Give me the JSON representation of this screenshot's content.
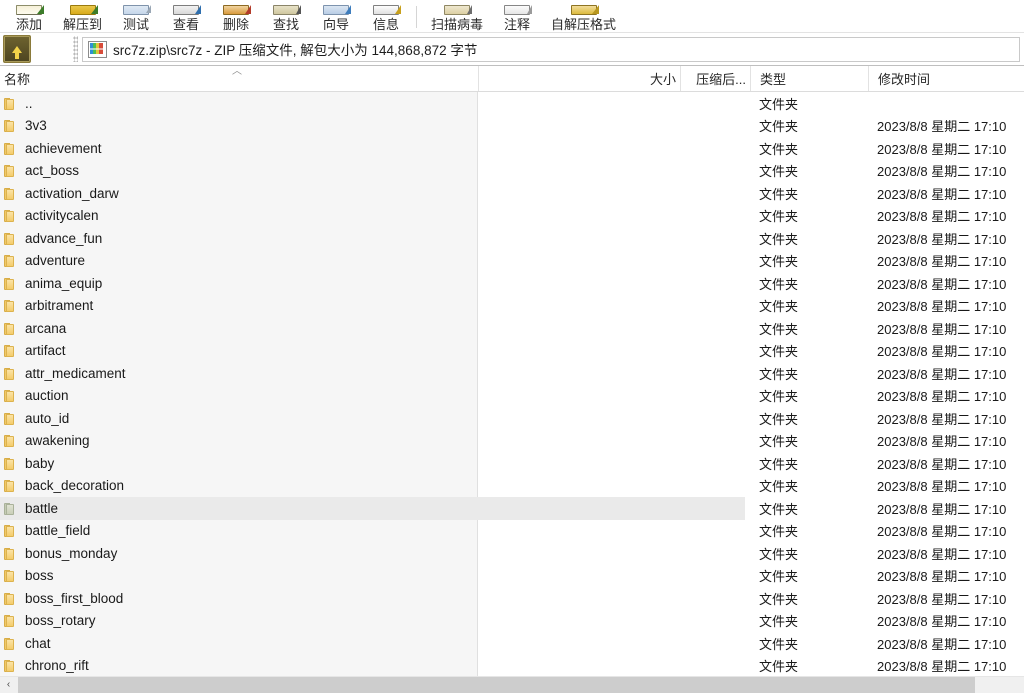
{
  "toolbar": {
    "buttons": [
      {
        "label": "添加",
        "icon": "add-archive-icon",
        "key": "add"
      },
      {
        "label": "解压到",
        "icon": "extract-to-icon",
        "key": "extract"
      },
      {
        "label": "测试",
        "icon": "test-archive-icon",
        "key": "test"
      },
      {
        "label": "查看",
        "icon": "view-file-icon",
        "key": "view"
      },
      {
        "label": "删除",
        "icon": "delete-icon",
        "key": "del"
      },
      {
        "label": "查找",
        "icon": "find-icon",
        "key": "find"
      },
      {
        "label": "向导",
        "icon": "wizard-icon",
        "key": "wizard"
      },
      {
        "label": "信息",
        "icon": "info-icon",
        "key": "info"
      },
      {
        "label": "扫描病毒",
        "icon": "virus-scan-icon",
        "key": "virus"
      },
      {
        "label": "注释",
        "icon": "comment-icon",
        "key": "comment"
      },
      {
        "label": "自解压格式",
        "icon": "sfx-icon",
        "key": "sfx"
      }
    ],
    "separator_after_index": 7
  },
  "addressbar": {
    "up_button_icon": "up-one-level-icon",
    "archive_icon": "zip-archive-icon",
    "path_text": "src7z.zip\\src7z - ZIP 压缩文件, 解包大小为 144,868,872 字节"
  },
  "columns": {
    "name": "名称",
    "size": "大小",
    "packed": "压缩后...",
    "type": "类型",
    "modified": "修改时间",
    "sort_indicator": "︿",
    "sorted_by": "名称"
  },
  "rows": [
    {
      "name": "..",
      "size": "",
      "packed": "",
      "type": "文件夹",
      "modified": "",
      "selected": false
    },
    {
      "name": "3v3",
      "size": "",
      "packed": "",
      "type": "文件夹",
      "modified": "2023/8/8 星期二 17:10",
      "selected": false
    },
    {
      "name": "achievement",
      "size": "",
      "packed": "",
      "type": "文件夹",
      "modified": "2023/8/8 星期二 17:10",
      "selected": false
    },
    {
      "name": "act_boss",
      "size": "",
      "packed": "",
      "type": "文件夹",
      "modified": "2023/8/8 星期二 17:10",
      "selected": false
    },
    {
      "name": "activation_darw",
      "size": "",
      "packed": "",
      "type": "文件夹",
      "modified": "2023/8/8 星期二 17:10",
      "selected": false
    },
    {
      "name": "activitycalen",
      "size": "",
      "packed": "",
      "type": "文件夹",
      "modified": "2023/8/8 星期二 17:10",
      "selected": false
    },
    {
      "name": "advance_fun",
      "size": "",
      "packed": "",
      "type": "文件夹",
      "modified": "2023/8/8 星期二 17:10",
      "selected": false
    },
    {
      "name": "adventure",
      "size": "",
      "packed": "",
      "type": "文件夹",
      "modified": "2023/8/8 星期二 17:10",
      "selected": false
    },
    {
      "name": "anima_equip",
      "size": "",
      "packed": "",
      "type": "文件夹",
      "modified": "2023/8/8 星期二 17:10",
      "selected": false
    },
    {
      "name": "arbitrament",
      "size": "",
      "packed": "",
      "type": "文件夹",
      "modified": "2023/8/8 星期二 17:10",
      "selected": false
    },
    {
      "name": "arcana",
      "size": "",
      "packed": "",
      "type": "文件夹",
      "modified": "2023/8/8 星期二 17:10",
      "selected": false
    },
    {
      "name": "artifact",
      "size": "",
      "packed": "",
      "type": "文件夹",
      "modified": "2023/8/8 星期二 17:10",
      "selected": false
    },
    {
      "name": "attr_medicament",
      "size": "",
      "packed": "",
      "type": "文件夹",
      "modified": "2023/8/8 星期二 17:10",
      "selected": false
    },
    {
      "name": "auction",
      "size": "",
      "packed": "",
      "type": "文件夹",
      "modified": "2023/8/8 星期二 17:10",
      "selected": false
    },
    {
      "name": "auto_id",
      "size": "",
      "packed": "",
      "type": "文件夹",
      "modified": "2023/8/8 星期二 17:10",
      "selected": false
    },
    {
      "name": "awakening",
      "size": "",
      "packed": "",
      "type": "文件夹",
      "modified": "2023/8/8 星期二 17:10",
      "selected": false
    },
    {
      "name": "baby",
      "size": "",
      "packed": "",
      "type": "文件夹",
      "modified": "2023/8/8 星期二 17:10",
      "selected": false
    },
    {
      "name": "back_decoration",
      "size": "",
      "packed": "",
      "type": "文件夹",
      "modified": "2023/8/8 星期二 17:10",
      "selected": false
    },
    {
      "name": "battle",
      "size": "",
      "packed": "",
      "type": "文件夹",
      "modified": "2023/8/8 星期二 17:10",
      "selected": true
    },
    {
      "name": "battle_field",
      "size": "",
      "packed": "",
      "type": "文件夹",
      "modified": "2023/8/8 星期二 17:10",
      "selected": false
    },
    {
      "name": "bonus_monday",
      "size": "",
      "packed": "",
      "type": "文件夹",
      "modified": "2023/8/8 星期二 17:10",
      "selected": false
    },
    {
      "name": "boss",
      "size": "",
      "packed": "",
      "type": "文件夹",
      "modified": "2023/8/8 星期二 17:10",
      "selected": false
    },
    {
      "name": "boss_first_blood",
      "size": "",
      "packed": "",
      "type": "文件夹",
      "modified": "2023/8/8 星期二 17:10",
      "selected": false
    },
    {
      "name": "boss_rotary",
      "size": "",
      "packed": "",
      "type": "文件夹",
      "modified": "2023/8/8 星期二 17:10",
      "selected": false
    },
    {
      "name": "chat",
      "size": "",
      "packed": "",
      "type": "文件夹",
      "modified": "2023/8/8 星期二 17:10",
      "selected": false
    },
    {
      "name": "chrono_rift",
      "size": "",
      "packed": "",
      "type": "文件夹",
      "modified": "2023/8/8 星期二 17:10",
      "selected": false
    }
  ],
  "hscrollbar": {
    "left_arrow_glyph": "‹",
    "thumb_position_percent": 0
  },
  "colors": {
    "folder": "#f4cc6b",
    "selection": "#eaeaea",
    "name_column_bg": "#f6f6f6",
    "text": "#191919"
  }
}
